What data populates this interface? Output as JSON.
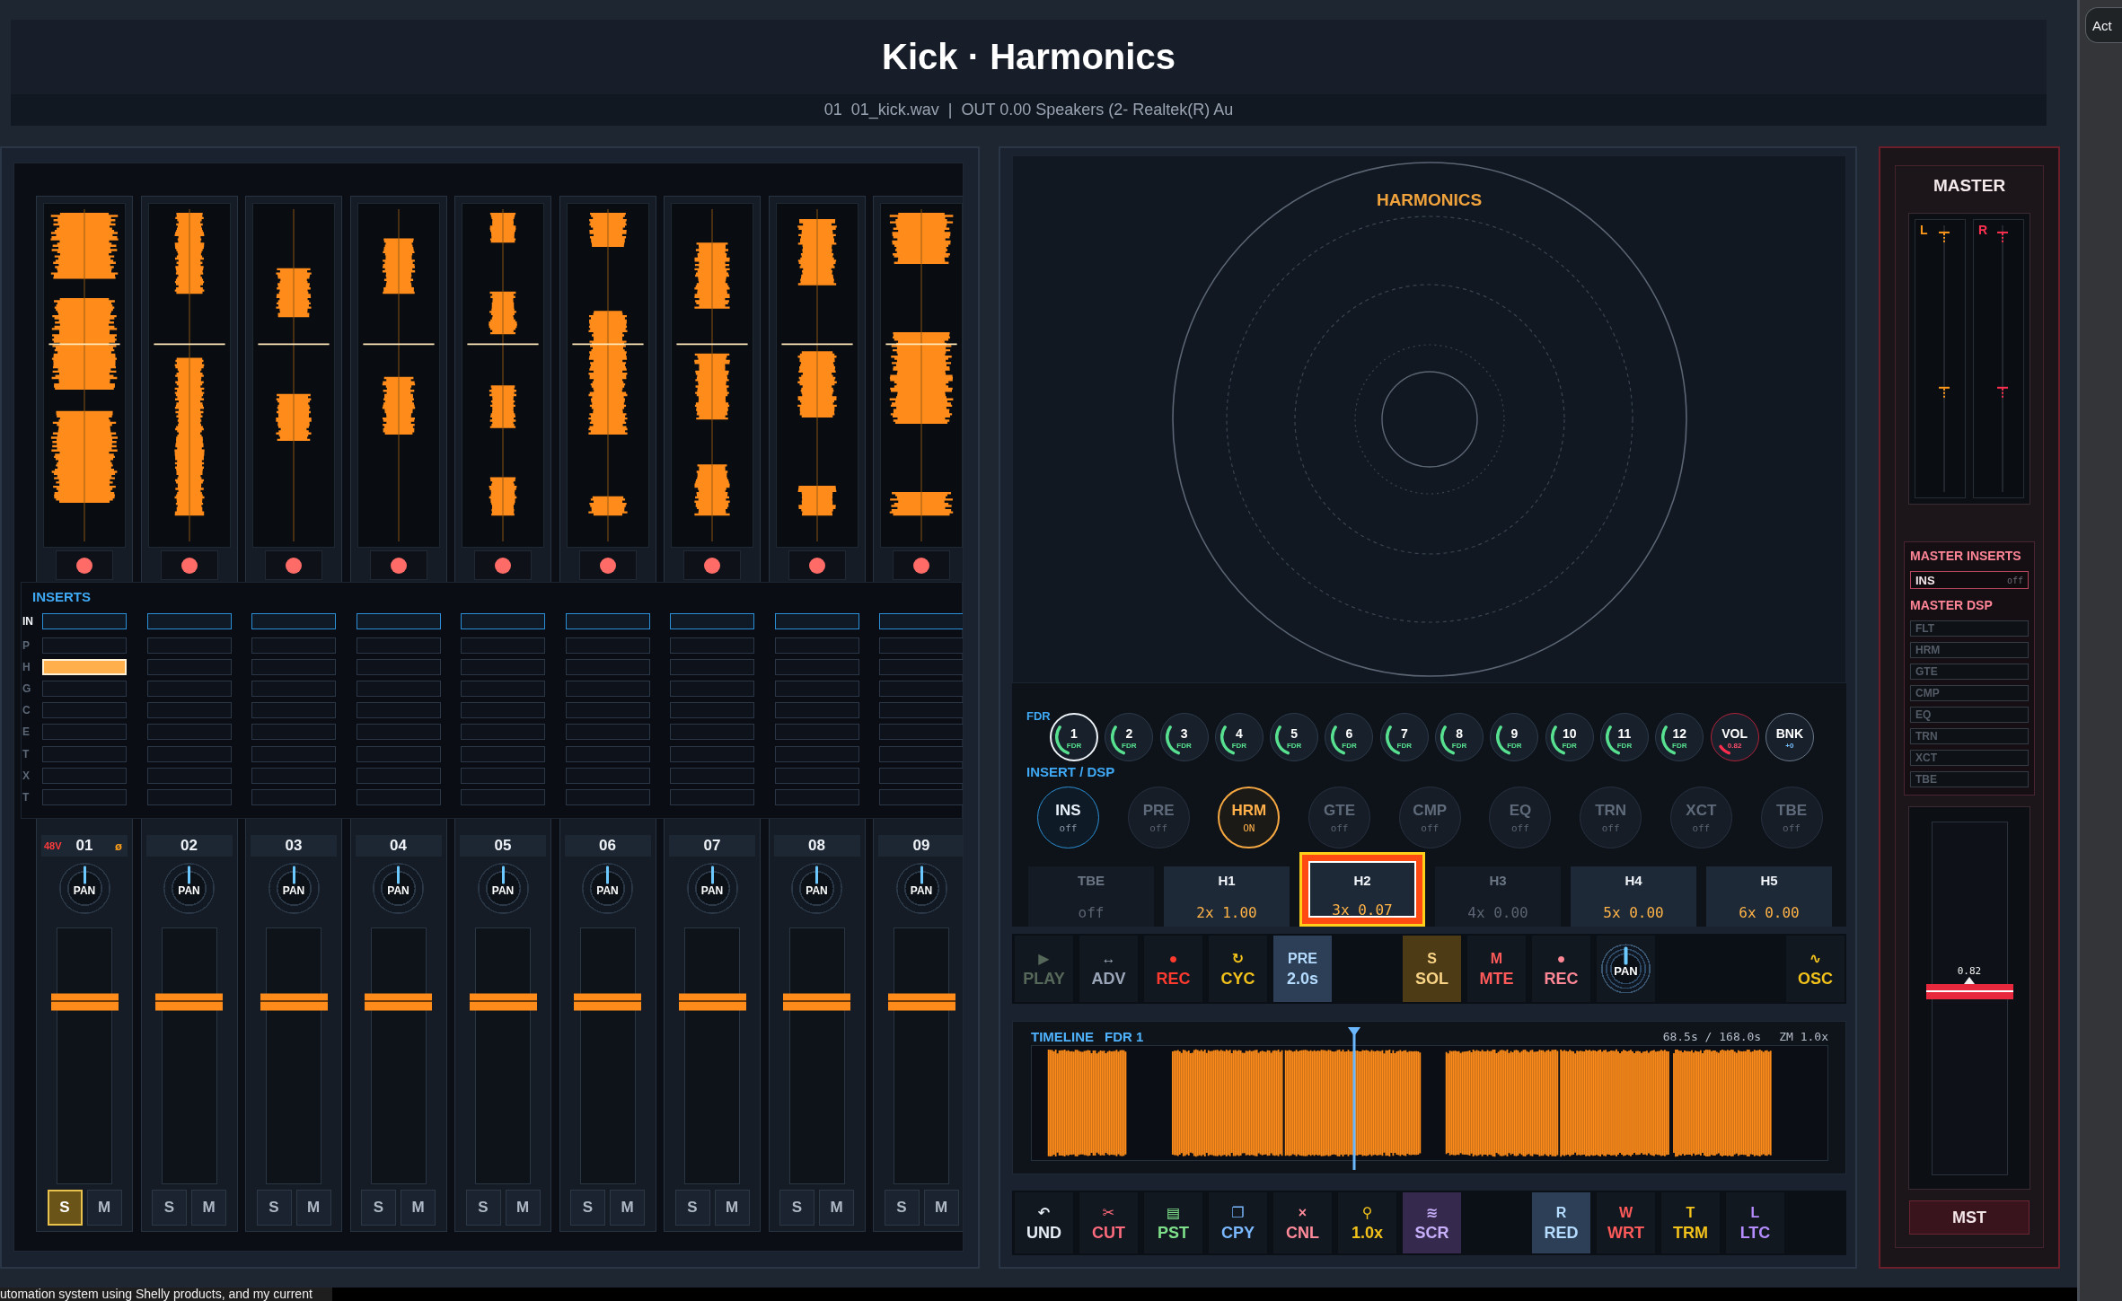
{
  "header": {
    "title": "Kick · Harmonics",
    "subtitle": "01  01_kick.wav  |  OUT 0.00 Speakers (2- Realtek(R) Au"
  },
  "channels": [
    {
      "number": "01",
      "phantom": "48V",
      "phase": "ø",
      "pan": {
        "label": "PAN",
        "level": 0.5
      },
      "fader": {
        "level": 0.71
      },
      "solo": {
        "label": "S",
        "on": true
      },
      "mute": {
        "label": "M",
        "on": false
      },
      "inserts": [
        false,
        false,
        true,
        false,
        false,
        false,
        false,
        false,
        false
      ]
    },
    {
      "number": "02",
      "pan": {
        "label": "PAN",
        "level": 0.5
      },
      "fader": {
        "level": 0.71
      },
      "solo": {
        "label": "S",
        "on": false
      },
      "mute": {
        "label": "M",
        "on": false
      },
      "inserts": [
        false,
        false,
        false,
        false,
        false,
        false,
        false,
        false,
        false
      ]
    },
    {
      "number": "03",
      "pan": {
        "label": "PAN",
        "level": 0.5
      },
      "fader": {
        "level": 0.71
      },
      "solo": {
        "label": "S",
        "on": false
      },
      "mute": {
        "label": "M",
        "on": false
      },
      "inserts": [
        false,
        false,
        false,
        false,
        false,
        false,
        false,
        false,
        false
      ]
    },
    {
      "number": "04",
      "pan": {
        "label": "PAN",
        "level": 0.5
      },
      "fader": {
        "level": 0.71
      },
      "solo": {
        "label": "S",
        "on": false
      },
      "mute": {
        "label": "M",
        "on": false
      },
      "inserts": [
        false,
        false,
        false,
        false,
        false,
        false,
        false,
        false,
        false
      ]
    },
    {
      "number": "05",
      "pan": {
        "label": "PAN",
        "level": 0.5
      },
      "fader": {
        "level": 0.71
      },
      "solo": {
        "label": "S",
        "on": false
      },
      "mute": {
        "label": "M",
        "on": false
      },
      "inserts": [
        false,
        false,
        false,
        false,
        false,
        false,
        false,
        false,
        false
      ]
    },
    {
      "number": "06",
      "pan": {
        "label": "PAN",
        "level": 0.5
      },
      "fader": {
        "level": 0.71
      },
      "solo": {
        "label": "S",
        "on": false
      },
      "mute": {
        "label": "M",
        "on": false
      },
      "inserts": [
        false,
        false,
        false,
        false,
        false,
        false,
        false,
        false,
        false
      ]
    },
    {
      "number": "07",
      "pan": {
        "label": "PAN",
        "level": 0.5
      },
      "fader": {
        "level": 0.71
      },
      "solo": {
        "label": "S",
        "on": false
      },
      "mute": {
        "label": "M",
        "on": false
      },
      "inserts": [
        false,
        false,
        false,
        false,
        false,
        false,
        false,
        false,
        false
      ]
    },
    {
      "number": "08",
      "pan": {
        "label": "PAN",
        "level": 0.5
      },
      "fader": {
        "level": 0.71
      },
      "solo": {
        "label": "S",
        "on": false
      },
      "mute": {
        "label": "M",
        "on": false
      },
      "inserts": [
        false,
        false,
        false,
        false,
        false,
        false,
        false,
        false,
        false
      ]
    },
    {
      "number": "09",
      "pan": {
        "label": "PAN",
        "level": 0.5
      },
      "fader": {
        "level": 0.71
      },
      "solo": {
        "label": "S",
        "on": false
      },
      "mute": {
        "label": "M",
        "on": false
      },
      "inserts": [
        false,
        false,
        false,
        false,
        false,
        false,
        false,
        false,
        false
      ]
    }
  ],
  "inserts": {
    "title": "INSERTS",
    "rows": [
      {
        "label": "IN",
        "kind": "ins"
      },
      {
        "label": "P",
        "kind": "dsp"
      },
      {
        "label": "H",
        "kind": "dsp"
      },
      {
        "label": "G",
        "kind": "dsp"
      },
      {
        "label": "C",
        "kind": "dsp"
      },
      {
        "label": "E",
        "kind": "dsp"
      },
      {
        "label": "T",
        "kind": "dsp"
      },
      {
        "label": "X",
        "kind": "dsp"
      },
      {
        "label": "T",
        "kind": "dsp"
      }
    ]
  },
  "harmonics": {
    "title": "HARMONICS"
  },
  "fdr": {
    "label": "FDR",
    "knobs": [
      {
        "kind": "fader",
        "label": "1",
        "sub": "FDR",
        "level": 0.35,
        "selected": true
      },
      {
        "kind": "fader",
        "label": "2",
        "sub": "FDR",
        "level": 0.35,
        "selected": false
      },
      {
        "kind": "fader",
        "label": "3",
        "sub": "FDR",
        "level": 0.35,
        "selected": false
      },
      {
        "kind": "fader",
        "label": "4",
        "sub": "FDR",
        "level": 0.35,
        "selected": false
      },
      {
        "kind": "fader",
        "label": "5",
        "sub": "FDR",
        "level": 0.35,
        "selected": false
      },
      {
        "kind": "fader",
        "label": "6",
        "sub": "FDR",
        "level": 0.35,
        "selected": false
      },
      {
        "kind": "fader",
        "label": "7",
        "sub": "FDR",
        "level": 0.35,
        "selected": false
      },
      {
        "kind": "fader",
        "label": "8",
        "sub": "FDR",
        "level": 0.35,
        "selected": false
      },
      {
        "kind": "fader",
        "label": "9",
        "sub": "FDR",
        "level": 0.35,
        "selected": false
      },
      {
        "kind": "fader",
        "label": "10",
        "sub": "FDR",
        "level": 0.35,
        "selected": false
      },
      {
        "kind": "fader",
        "label": "11",
        "sub": "FDR",
        "level": 0.35,
        "selected": false
      },
      {
        "kind": "fader",
        "label": "12",
        "sub": "FDR",
        "level": 0.35,
        "selected": false
      },
      {
        "kind": "volume",
        "label": "VOL",
        "sub": "0.82",
        "level": 0.12,
        "selected": false
      },
      {
        "kind": "bank",
        "label": "BNK",
        "sub": "+0",
        "selected": false
      }
    ]
  },
  "insert_dsp": {
    "label": "INSERT / DSP",
    "modules": [
      {
        "label": "INS",
        "status": "off",
        "on": false,
        "selected": true
      },
      {
        "label": "PRE",
        "status": "off",
        "on": false,
        "selected": false
      },
      {
        "label": "HRM",
        "status": "ON",
        "on": true,
        "selected": false
      },
      {
        "label": "GTE",
        "status": "off",
        "on": false,
        "selected": false
      },
      {
        "label": "CMP",
        "status": "off",
        "on": false,
        "selected": false
      },
      {
        "label": "EQ",
        "status": "off",
        "on": false,
        "selected": false
      },
      {
        "label": "TRN",
        "status": "off",
        "on": false,
        "selected": false
      },
      {
        "label": "XCT",
        "status": "off",
        "on": false,
        "selected": false
      },
      {
        "label": "TBE",
        "status": "off",
        "on": false,
        "selected": false
      }
    ]
  },
  "harmonic_slots": [
    {
      "label": "TBE",
      "value": "off",
      "active": false,
      "selected": false
    },
    {
      "label": "H1",
      "value": "2x 1.00",
      "active": true,
      "selected": false
    },
    {
      "label": "H2",
      "value": "3x 0.07",
      "active": true,
      "selected": true
    },
    {
      "label": "H3",
      "value": "4x 0.00",
      "active": false,
      "selected": false
    },
    {
      "label": "H4",
      "value": "5x 0.00",
      "active": true,
      "selected": false
    },
    {
      "label": "H5",
      "value": "6x 0.00",
      "active": true,
      "selected": false
    }
  ],
  "transport": {
    "left": [
      {
        "kind": "button",
        "top": "▶",
        "label": "PLAY",
        "color": "#56685a",
        "active": false
      },
      {
        "kind": "button",
        "top": "↔",
        "label": "ADV",
        "color": "#9aa6b8",
        "active": false
      },
      {
        "kind": "button",
        "top": "●",
        "label": "REC",
        "color": "#ff3b30",
        "active": false
      },
      {
        "kind": "button",
        "top": "↻",
        "label": "CYC",
        "color": "#f2c21b",
        "active": false
      },
      {
        "kind": "button",
        "top": "PRE",
        "label": "2.0s",
        "color": "#2c3f56",
        "active": true
      }
    ],
    "middle": [
      {
        "kind": "button",
        "top": "S",
        "label": "SOL",
        "color": "#4d3b16",
        "active": true
      },
      {
        "kind": "button",
        "top": "M",
        "label": "MTE",
        "color": "#ff5a5a",
        "active": false
      },
      {
        "kind": "button",
        "top": "●",
        "label": "REC",
        "color": "#ff8796",
        "active": false
      },
      {
        "kind": "knob",
        "label": "PAN",
        "level": 0.5
      }
    ],
    "right": [
      {
        "kind": "button",
        "top": "∿",
        "label": "OSC",
        "color": "#f2c21b",
        "active": false
      }
    ]
  },
  "timeline": {
    "title": "TIMELINE",
    "track": "FDR 1",
    "position": "68.5s / 168.0s",
    "zoom": "ZM 1.0x",
    "playhead": {
      "level": 0.405
    }
  },
  "edit_toolbar": {
    "left": [
      {
        "top": "↶",
        "label": "UND",
        "color": "#e6edf5",
        "active": false
      },
      {
        "top": "✂",
        "label": "CUT",
        "color": "#ff6b7d",
        "active": false
      },
      {
        "top": "▤",
        "label": "PST",
        "color": "#7ee08a",
        "active": false
      },
      {
        "top": "❐",
        "label": "CPY",
        "color": "#7ab8ff",
        "active": false
      },
      {
        "top": "×",
        "label": "CNL",
        "color": "#ff8a9a",
        "active": false
      },
      {
        "top": "⚲",
        "label": "1.0x",
        "color": "#f2c21b",
        "active": false
      },
      {
        "top": "≋",
        "label": "SCR",
        "color": "#35294d",
        "active": true
      }
    ],
    "right": [
      {
        "top": "R",
        "label": "RED",
        "color": "#2c3f56",
        "active": true
      },
      {
        "top": "W",
        "label": "WRT",
        "color": "#ff5a5a",
        "active": false
      },
      {
        "top": "T",
        "label": "TRM",
        "color": "#f2c21b",
        "active": false
      },
      {
        "top": "L",
        "label": "LTC",
        "color": "#b48cff",
        "active": false
      }
    ]
  },
  "master": {
    "title": "MASTER",
    "meters": [
      {
        "label": "L",
        "color": "#ff9a1a"
      },
      {
        "label": "R",
        "color": "#ff3150"
      }
    ],
    "inserts_title": "MASTER INSERTS",
    "insert": {
      "label": "INS",
      "status": "off"
    },
    "dsp_title": "MASTER DSP",
    "dsp": [
      {
        "label": "FLT",
        "on": false
      },
      {
        "label": "HRM",
        "on": false
      },
      {
        "label": "GTE",
        "on": false
      },
      {
        "label": "CMP",
        "on": false
      },
      {
        "label": "EQ",
        "on": false
      },
      {
        "label": "TRN",
        "on": false
      },
      {
        "label": "XCT",
        "on": false
      },
      {
        "label": "TBE",
        "on": false
      }
    ],
    "fader": {
      "reading": "0.82",
      "level": 0.52
    },
    "button": "MST"
  },
  "side_window": {
    "button": "Act"
  },
  "bottom_window": {
    "text": "utomation system using Shelly products, and my current"
  }
}
